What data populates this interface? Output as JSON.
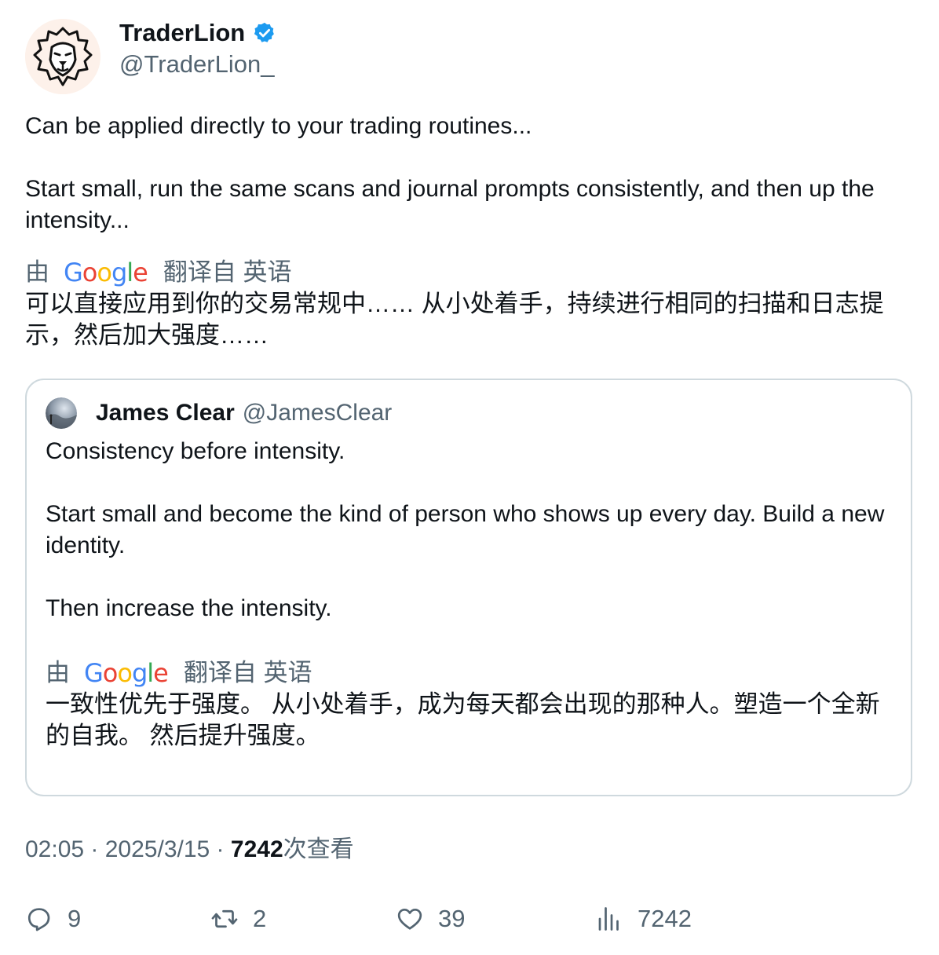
{
  "author": {
    "display_name": "TraderLion",
    "handle": "@TraderLion_",
    "verified": true,
    "avatar_icon": "lion-logo-icon",
    "verified_color": "#1d9bf0"
  },
  "tweet": {
    "paragraphs": [
      "Can be applied directly to your trading routines...",
      "Start small, run the same scans and journal prompts consistently, and then up the intensity..."
    ],
    "translation": {
      "by_label": "由",
      "google_label": "Google",
      "from_label": "翻译自 英语",
      "text": "可以直接应用到你的交易常规中…… 从小处着手，持续进行相同的扫描和日志提示，然后加大强度……"
    }
  },
  "quoted_tweet": {
    "display_name": "James Clear",
    "handle": "@JamesClear",
    "paragraphs": [
      "Consistency before intensity.",
      "Start small and become the kind of person who shows up every day. Build a new identity.",
      "Then increase the intensity."
    ],
    "translation": {
      "by_label": "由",
      "google_label": "Google",
      "from_label": "翻译自 英语",
      "text": "一致性优先于强度。 从小处着手，成为每天都会出现的那种人。塑造一个全新的自我。 然后提升强度。"
    }
  },
  "meta": {
    "time": "02:05",
    "separator": " · ",
    "date": "2025/3/15",
    "views_count": "7242",
    "views_label": "次查看"
  },
  "actions": {
    "replies": "9",
    "retweets": "2",
    "likes": "39",
    "views": "7242"
  },
  "colors": {
    "text_primary": "#0f1419",
    "text_secondary": "#536471",
    "border": "#cfd9de",
    "google_blue": "#4285F4",
    "google_red": "#EA4335",
    "google_yellow": "#FBBC05",
    "google_green": "#34A853"
  }
}
